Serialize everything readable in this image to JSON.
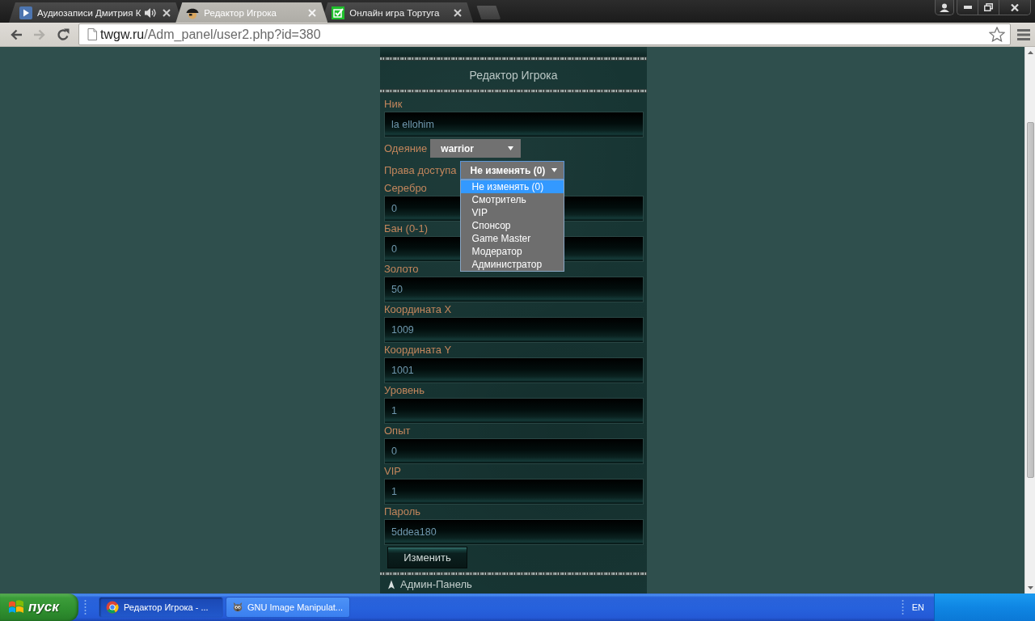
{
  "browser": {
    "tabs": [
      {
        "title": "Аудиозаписи Дмитрия К",
        "kind": "audio",
        "selected": false,
        "playing": true
      },
      {
        "title": "Редактор Игрока",
        "kind": "pirate",
        "selected": true,
        "playing": false
      },
      {
        "title": "Онлайн игра Тортуга",
        "kind": "check",
        "selected": false,
        "playing": false
      }
    ],
    "can_go_back": true,
    "can_go_forward": false,
    "address": {
      "host": "twgw.ru",
      "path": "/Adm_panel/user2.php?id=380"
    }
  },
  "panel": {
    "title": "Редактор Игрока",
    "fields": [
      {
        "kind": "text",
        "label": "Ник",
        "value": "la ellohim"
      },
      {
        "kind": "select",
        "label": "Одеяние",
        "value": "warrior",
        "expanded": false
      },
      {
        "kind": "select",
        "label": "Права доступа",
        "value": "Не изменять (0)",
        "expanded": true,
        "options": [
          {
            "label": "Не изменять (0)",
            "selected": true
          },
          {
            "label": "Смотритель",
            "selected": false
          },
          {
            "label": "VIP",
            "selected": false
          },
          {
            "label": "Спонсор",
            "selected": false
          },
          {
            "label": "Game Master",
            "selected": false
          },
          {
            "label": "Модератор",
            "selected": false
          },
          {
            "label": "Администратор",
            "selected": false
          }
        ]
      },
      {
        "kind": "text",
        "label": "Серебро",
        "value": "0"
      },
      {
        "kind": "text",
        "label": "Бан (0-1)",
        "value": "0"
      },
      {
        "kind": "text",
        "label": "Золото",
        "value": "50"
      },
      {
        "kind": "text",
        "label": "Координата X",
        "value": "1009"
      },
      {
        "kind": "text",
        "label": "Координата Y",
        "value": "1001"
      },
      {
        "kind": "text",
        "label": "Уровень",
        "value": "1"
      },
      {
        "kind": "text",
        "label": "Опыт",
        "value": "0"
      },
      {
        "kind": "text",
        "label": "VIP",
        "value": "1"
      },
      {
        "kind": "text",
        "label": "Пароль",
        "value": "5ddea180"
      }
    ],
    "submit": "Изменить",
    "menu": [
      {
        "label": "Админ-Панель"
      }
    ]
  },
  "taskbar": {
    "start": "пуск",
    "tasks": [
      {
        "label": "Редактор Игрока - ...",
        "kind": "browser",
        "selected": true
      },
      {
        "label": "GNU Image Manipulat...",
        "kind": "painter",
        "selected": false
      }
    ],
    "language": "EN"
  }
}
